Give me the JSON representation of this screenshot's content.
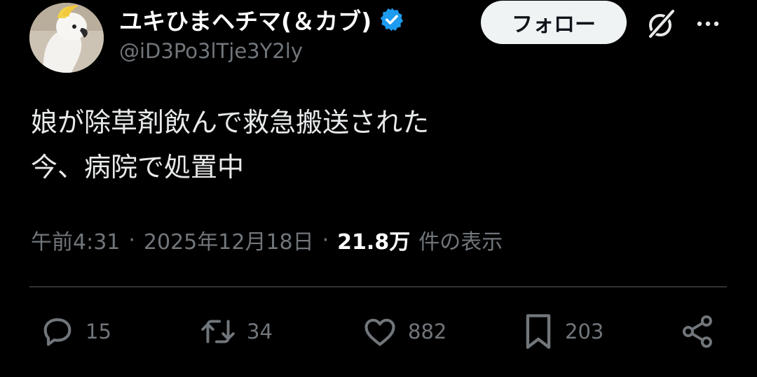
{
  "author": {
    "display_name": "ユキひまヘチマ(＆カブ)",
    "handle": "@iD3Po3lTje3Y2ly",
    "verified_icon": "verified-badge-icon",
    "avatar_icon": "cockatoo-avatar"
  },
  "header": {
    "follow_label": "フォロー",
    "grok_icon": "grok-icon",
    "more_icon": "more-dots-icon"
  },
  "tweet": {
    "lines": [
      "娘が除草剤飲んで救急搬送された",
      "今、病院で処置中"
    ]
  },
  "meta": {
    "time": "午前4:31",
    "separator": "·",
    "date": "2025年12月18日",
    "views_count": "21.8万",
    "views_label": "件の表示"
  },
  "actions": {
    "reply": {
      "icon": "reply-icon",
      "count": "15"
    },
    "retweet": {
      "icon": "retweet-icon",
      "count": "34"
    },
    "like": {
      "icon": "heart-icon",
      "count": "882"
    },
    "bookmark": {
      "icon": "bookmark-icon",
      "count": "203"
    },
    "share": {
      "icon": "share-icon"
    }
  },
  "colors": {
    "background": "#000000",
    "text": "#e7e9ea",
    "secondary": "#71767b",
    "verified": "#1d9bf0",
    "follow_bg": "#eff3f4",
    "divider": "#2f3336"
  }
}
